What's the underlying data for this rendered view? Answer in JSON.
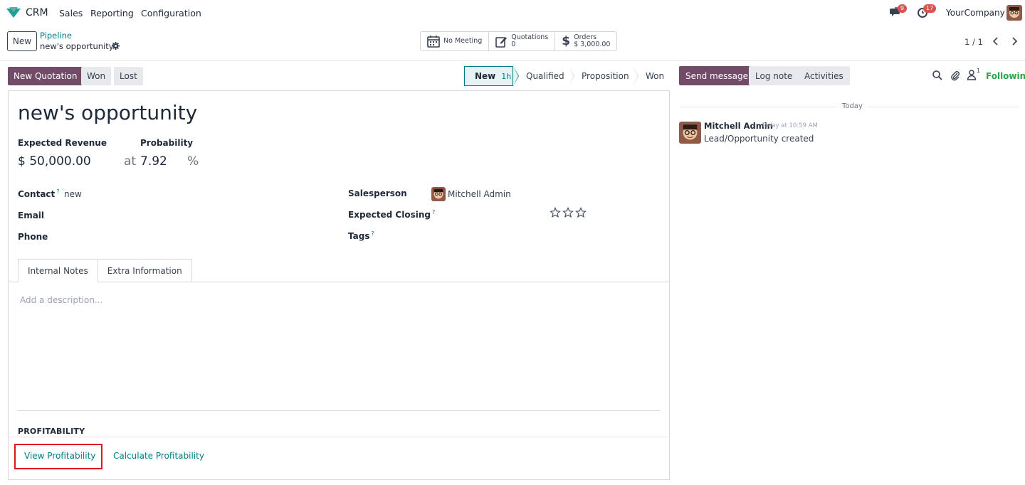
{
  "navbar": {
    "app_name": "CRM",
    "menu": [
      "Sales",
      "Reporting",
      "Configuration"
    ],
    "messages_badge": "9",
    "activities_badge": "17",
    "company": "YourCompany"
  },
  "control_panel": {
    "new_label": "New",
    "breadcrumb_parent": "Pipeline",
    "breadcrumb_current": "new's opportunity",
    "smart_buttons": {
      "meeting": "No Meeting",
      "quotations_label": "Quotations",
      "quotations_count": "0",
      "orders_label": "Orders",
      "orders_amount": "$ 3,000.00"
    },
    "pager": "1 / 1"
  },
  "actions": {
    "new_quotation": "New Quotation",
    "won": "Won",
    "lost": "Lost"
  },
  "stages": [
    {
      "label": "New",
      "duration": "1h"
    },
    {
      "label": "Qualified"
    },
    {
      "label": "Proposition"
    },
    {
      "label": "Won"
    }
  ],
  "form": {
    "title": "new's opportunity",
    "expected_revenue_label": "Expected Revenue",
    "expected_revenue": "$ 50,000.00",
    "at": "at",
    "probability_label": "Probability",
    "probability": "7.92",
    "percent": "%",
    "contact_label": "Contact",
    "contact_value": "new",
    "email_label": "Email",
    "phone_label": "Phone",
    "salesperson_label": "Salesperson",
    "salesperson": "Mitchell Admin",
    "expected_closing_label": "Expected Closing",
    "tags_label": "Tags",
    "help_mark": "?",
    "priority_stars": 0,
    "tabs": [
      "Internal Notes",
      "Extra Information"
    ],
    "description_placeholder": "Add a description...",
    "profitability_title": "PROFITABILITY",
    "view_profitability": "View Profitability",
    "calculate_profitability": "Calculate Profitability"
  },
  "chatter": {
    "send_message": "Send message",
    "log_note": "Log note",
    "activities": "Activities",
    "followers_count": "1",
    "following": "Following",
    "day_separator": "Today",
    "message": {
      "author": "Mitchell Admin",
      "date": "Today at 10:59 AM",
      "body": "Lead/Opportunity created"
    }
  },
  "colors": {
    "primary": "#714b67",
    "teal": "#017e84",
    "highlight": "#e0161e",
    "following": "#28a745"
  }
}
